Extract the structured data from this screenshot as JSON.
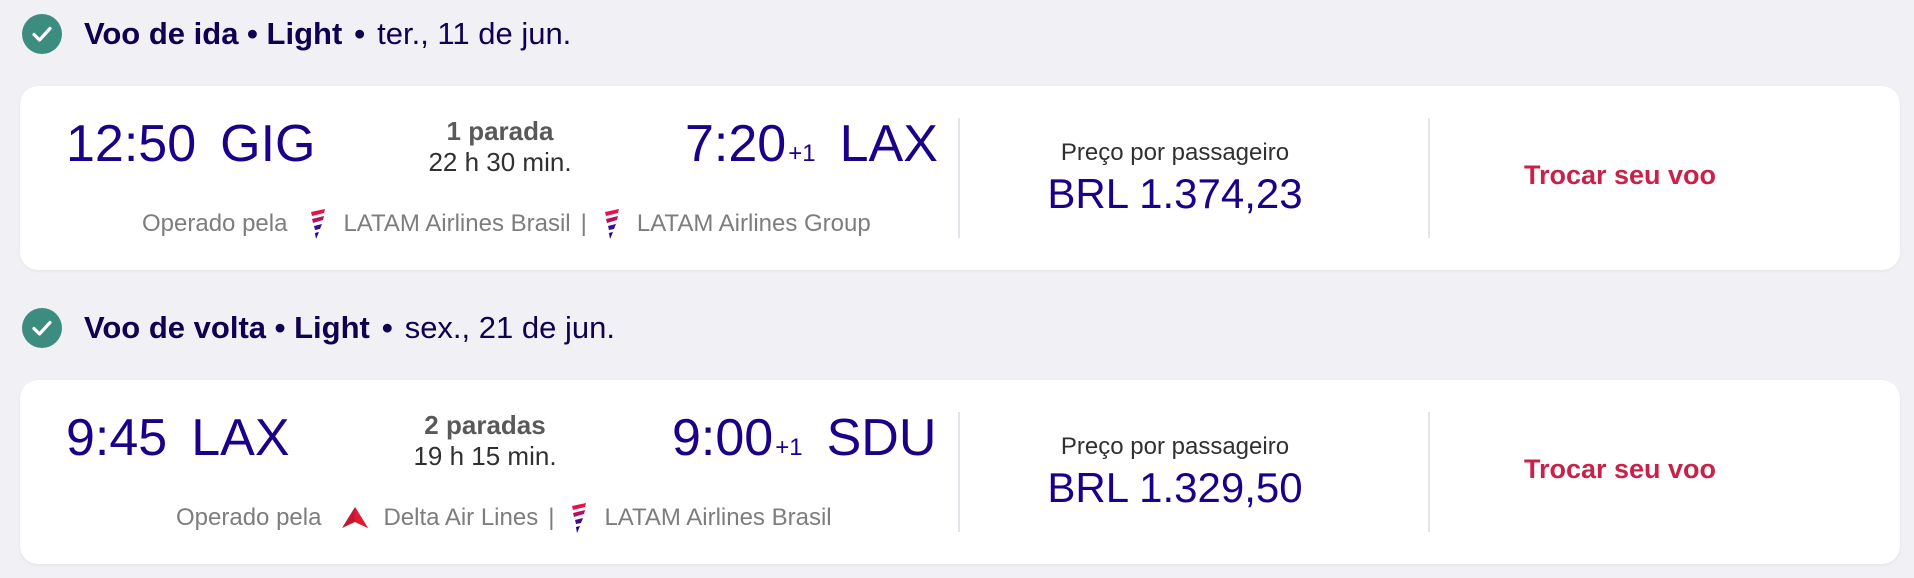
{
  "outbound": {
    "leg_label": "Voo de ida • Light",
    "date": "ter., 11 de jun.",
    "departure_time": "12:50",
    "departure_airport": "GIG",
    "stops": "1 parada",
    "duration": "22 h 30 min.",
    "arrival_time": "7:20",
    "arrival_plus_day": "+1",
    "arrival_airport": "LAX",
    "operated_by_label": "Operado pela",
    "operators": [
      "LATAM Airlines Brasil",
      "LATAM Airlines Group"
    ],
    "price_label": "Preço por passageiro",
    "price": "BRL 1.374,23",
    "change_label": "Trocar seu voo"
  },
  "return": {
    "leg_label": "Voo de volta • Light",
    "date": "sex., 21 de jun.",
    "departure_time": "9:45",
    "departure_airport": "LAX",
    "stops": "2 paradas",
    "duration": "19 h 15 min.",
    "arrival_time": "9:00",
    "arrival_plus_day": "+1",
    "arrival_airport": "SDU",
    "operated_by_label": "Operado pela",
    "operators": [
      "Delta Air Lines",
      "LATAM Airlines Brasil"
    ],
    "price_label": "Preço por passageiro",
    "price": "BRL 1.329,50",
    "change_label": "Trocar seu voo"
  },
  "separator": "|",
  "colors": {
    "check": "#3d8c80",
    "brand_navy": "#1b0088",
    "accent_red": "#c8224b"
  },
  "icons": [
    "check-icon",
    "latam-logo-icon",
    "delta-logo-icon"
  ]
}
